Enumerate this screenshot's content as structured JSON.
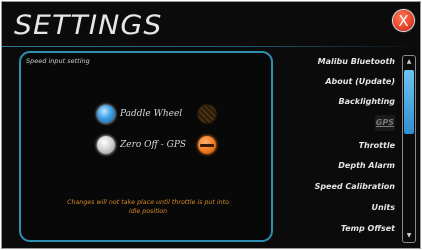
{
  "header": {
    "title": "SETTINGS",
    "close_label": "X"
  },
  "panel": {
    "label": "Speed input setting",
    "options": [
      {
        "label": "Paddle Wheel",
        "selected": true,
        "indicator": "dim"
      },
      {
        "label": "Zero Off - GPS",
        "selected": false,
        "indicator": "active"
      }
    ],
    "note": "Changes will not take place until throttle is put into idle position"
  },
  "menu": {
    "items": [
      {
        "label": "Malibu Bluetooth"
      },
      {
        "label": "About (Update)"
      },
      {
        "label": "Backlighting"
      },
      {
        "label": "GPS"
      },
      {
        "label": "Throttle"
      },
      {
        "label": "Depth Alarm"
      },
      {
        "label": "Speed Calibration"
      },
      {
        "label": "Units"
      },
      {
        "label": "Temp Offset"
      }
    ],
    "selected_index": 3
  },
  "scrollbar": {
    "up_icon": "chevron-up-icon",
    "down_icon": "chevron-down-icon",
    "position_fraction": 0.1
  },
  "colors": {
    "accent": "#2e8fb0",
    "close": "#e8462a",
    "note": "#d98a2a",
    "radio_on": "#3ba0e6",
    "indicator_on": "#f07a20"
  }
}
